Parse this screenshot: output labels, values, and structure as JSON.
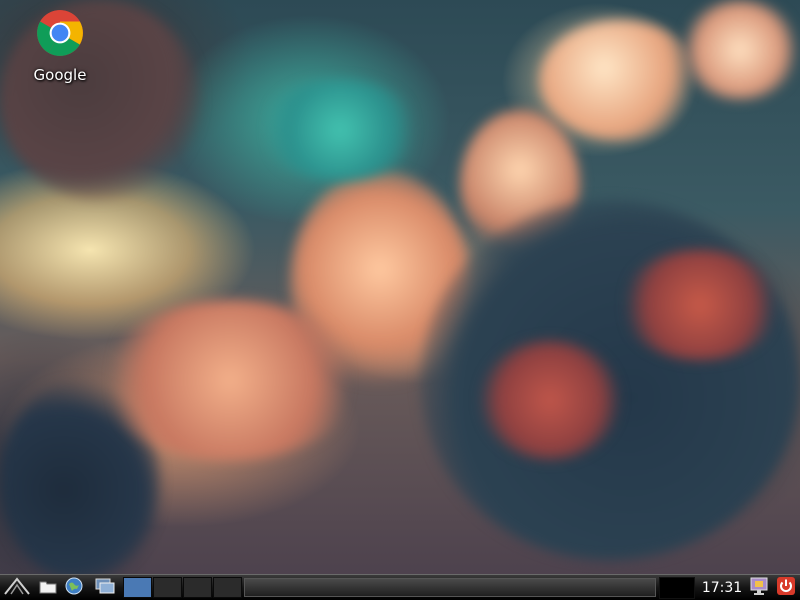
{
  "desktop": {
    "icons": [
      {
        "label": "Google",
        "icon": "chrome-icon"
      }
    ]
  },
  "taskbar": {
    "launchers": [
      "start-menu-icon",
      "file-manager-icon",
      "web-browser-icon",
      "show-desktop-icon"
    ],
    "workspaces": [
      {
        "active": true
      },
      {
        "active": false
      },
      {
        "active": false
      },
      {
        "active": false
      }
    ],
    "clock": "17:31",
    "tray": [
      "network-monitor-icon",
      "shutdown-icon"
    ]
  },
  "colors": {
    "workspace_active": "#4a79b4",
    "taskbar": "#151515",
    "shutdown": "#d83a2a"
  }
}
